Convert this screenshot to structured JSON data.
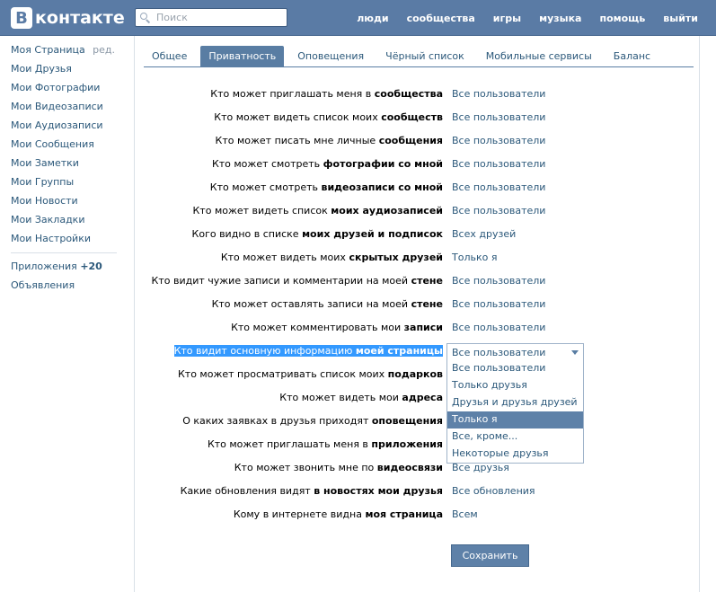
{
  "header": {
    "logo_letter": "В",
    "logo_text": "контакте",
    "search_placeholder": "Поиск",
    "nav": [
      "люди",
      "сообщества",
      "игры",
      "музыка",
      "помощь",
      "выйти"
    ]
  },
  "sidebar": {
    "edit_label": "ред.",
    "items": [
      "Моя Страница",
      "Мои Друзья",
      "Мои Фотографии",
      "Мои Видеозаписи",
      "Мои Аудиозаписи",
      "Мои Сообщения",
      "Мои Заметки",
      "Мои Группы",
      "Мои Новости",
      "Мои Закладки",
      "Мои Настройки"
    ],
    "apps_label": "Приложения",
    "apps_count": "+20",
    "ads_label": "Объявления"
  },
  "tabs": [
    {
      "label": "Общее",
      "active": false
    },
    {
      "label": "Приватность",
      "active": true
    },
    {
      "label": "Оповещения",
      "active": false
    },
    {
      "label": "Чёрный список",
      "active": false
    },
    {
      "label": "Мобильные сервисы",
      "active": false
    },
    {
      "label": "Баланс",
      "active": false
    }
  ],
  "privacy_rows": [
    {
      "pre": "Кто может приглашать меня в ",
      "bold": "сообщества",
      "value": "Все пользователи"
    },
    {
      "pre": "Кто может видеть список моих ",
      "bold": "сообществ",
      "value": "Все пользователи"
    },
    {
      "pre": "Кто может писать мне личные ",
      "bold": "сообщения",
      "value": "Все пользователи"
    },
    {
      "pre": "Кто может смотреть ",
      "bold": "фотографии со мной",
      "value": "Все пользователи"
    },
    {
      "pre": "Кто может смотреть ",
      "bold": "видеозаписи со мной",
      "value": "Все пользователи"
    },
    {
      "pre": "Кто может видеть список ",
      "bold": "моих аудиозаписей",
      "value": "Все пользователи"
    },
    {
      "pre": "Кого видно в списке ",
      "bold": "моих друзей и подписок",
      "value": "Всех друзей"
    },
    {
      "pre": "Кто может видеть моих ",
      "bold": "скрытых друзей",
      "value": "Только я"
    },
    {
      "pre": "Кто видит чужие записи и комментарии на моей ",
      "bold": "стене",
      "value": "Все пользователи"
    },
    {
      "pre": "Кто может оставлять записи на моей ",
      "bold": "стене",
      "value": "Все пользователи"
    },
    {
      "pre": "Кто может комментировать мои ",
      "bold": "записи",
      "value": "Все пользователи"
    },
    {
      "pre": "Кто видит основную информацию ",
      "bold": "моей страницы",
      "value": "",
      "selected": true
    },
    {
      "pre": "Кто может просматривать список моих ",
      "bold": "подарков",
      "value": ""
    },
    {
      "pre": "Кто может видеть мои ",
      "bold": "адреса",
      "value": ""
    },
    {
      "pre": "О каких заявках в друзья приходят ",
      "bold": "оповещения",
      "value": ""
    },
    {
      "pre": "Кто может приглашать меня в ",
      "bold": "приложения",
      "value": ""
    },
    {
      "pre": "Кто может звонить мне по ",
      "bold": "видеосвязи",
      "value": "Все друзья"
    },
    {
      "pre": "Какие обновления видят ",
      "bold": "в новостях мои друзья",
      "value": "Все обновления"
    },
    {
      "pre": "Кому в интернете видна ",
      "bold": "моя страница",
      "value": "Всем"
    }
  ],
  "dropdown": {
    "current": "Все пользователи",
    "options": [
      "Все пользователи",
      "Только друзья",
      "Друзья и друзья друзей",
      "Только я",
      "Все, кроме...",
      "Некоторые друзья"
    ],
    "highlighted_index": 3
  },
  "save_label": "Сохранить"
}
